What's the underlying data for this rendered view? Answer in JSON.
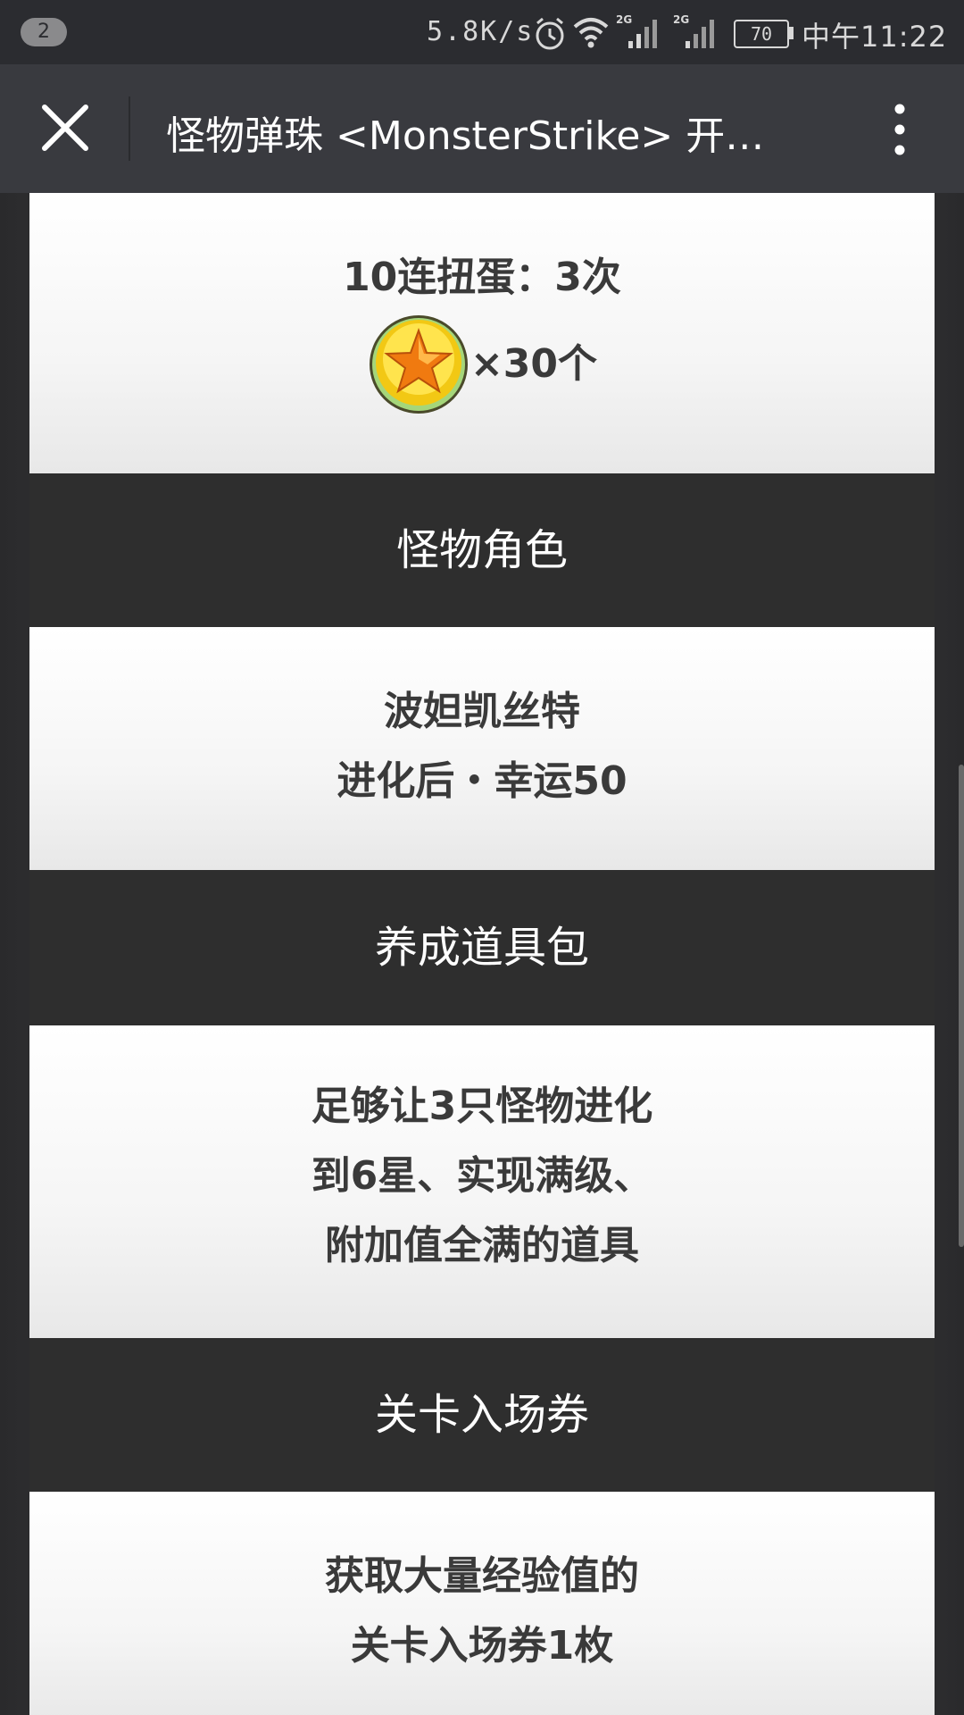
{
  "status_bar": {
    "notification_count": "2",
    "network_speed": "5.8K/s",
    "icons": [
      "alarm-icon",
      "wifi-icon",
      "signal-2g-icon",
      "signal-2g-icon"
    ],
    "network_type_1": "2G",
    "network_type_2": "2G",
    "battery_level": "70",
    "time": "中午11:22"
  },
  "title_bar": {
    "title": "怪物弹珠 <MonsterStrike> 开…",
    "close_icon": "close-icon",
    "more_icon": "more-vertical-icon"
  },
  "content": {
    "gacha": {
      "line1": "10连扭蛋：3次",
      "coin_icon": "star-coin-icon",
      "coin_count": "×30个"
    },
    "monster_section": {
      "header": "怪物角色",
      "line1": "波妲凯丝特",
      "line2": "进化后・幸运50"
    },
    "items_section": {
      "header": "养成道具包",
      "line1": "足够让3只怪物进化",
      "line2": "到6星、实现满级、",
      "line3": "附加值全满的道具"
    },
    "ticket_section": {
      "header": "关卡入场券",
      "line1": "获取大量经验值的",
      "line2": "关卡入场券1枚"
    }
  },
  "colors": {
    "status_bar_bg": "#2b2c30",
    "title_bar_bg": "#393a3f",
    "panel_dark_bg": "#2e2e2e",
    "panel_text": "#3a3a3a"
  }
}
